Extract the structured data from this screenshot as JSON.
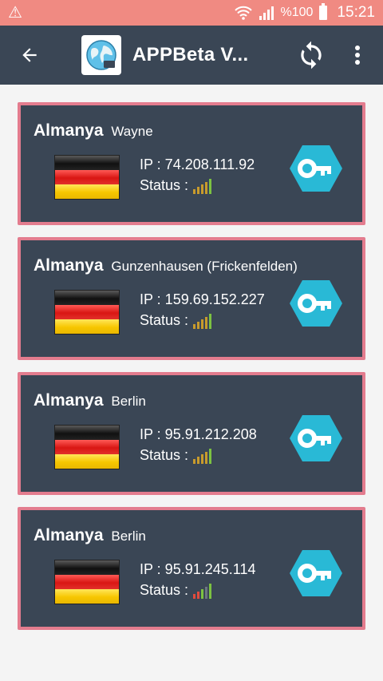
{
  "status_bar": {
    "battery_text": "%100",
    "time": "15:21"
  },
  "app_bar": {
    "title": "APPBeta V..."
  },
  "servers": [
    {
      "country": "Almanya",
      "city": "Wayne",
      "ip_text": "IP : 74.208.111.92",
      "status_label": "Status :",
      "signal_level": 4,
      "signal_color": "#c89b2c"
    },
    {
      "country": "Almanya",
      "city": "Gunzenhausen (Frickenfelden)",
      "ip_text": "IP : 159.69.152.227",
      "status_label": "Status :",
      "signal_level": 4,
      "signal_color": "#c89b2c"
    },
    {
      "country": "Almanya",
      "city": "Berlin",
      "ip_text": "IP : 95.91.212.208",
      "status_label": "Status :",
      "signal_level": 4,
      "signal_color": "#c89b2c"
    },
    {
      "country": "Almanya",
      "city": "Berlin",
      "ip_text": "IP : 95.91.245.114",
      "status_label": "Status :",
      "signal_level": 2,
      "signal_color": "#e14b3d"
    }
  ],
  "colors": {
    "accent": "#29b9d6",
    "card_border": "#e37c8e",
    "card_bg": "#3a4655",
    "status_bar": "#f08a82",
    "signal_green": "#7cc241"
  }
}
